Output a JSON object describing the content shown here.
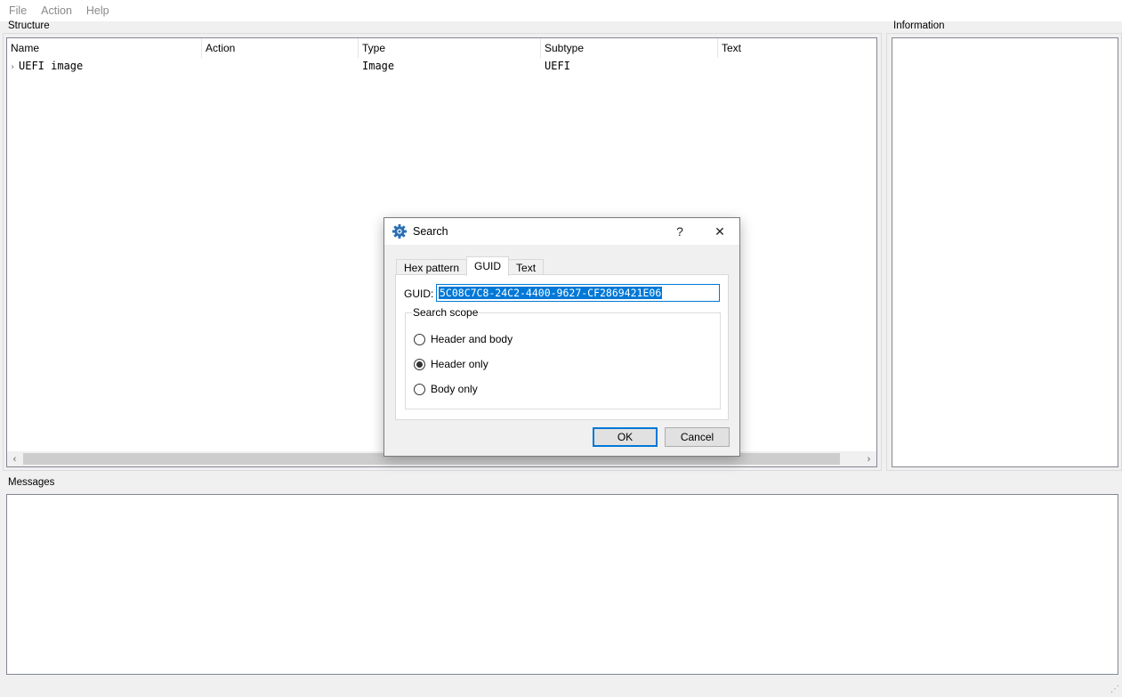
{
  "menubar": {
    "items": [
      "File",
      "Action",
      "Help"
    ]
  },
  "structure": {
    "label": "Structure",
    "columns": [
      "Name",
      "Action",
      "Type",
      "Subtype",
      "Text"
    ],
    "rows": [
      {
        "expander": "›",
        "name": "UEFI image",
        "action": "",
        "type": "Image",
        "subtype": "UEFI",
        "text": ""
      }
    ],
    "scroll_left": "‹",
    "scroll_right": "›"
  },
  "information": {
    "label": "Information"
  },
  "messages": {
    "label": "Messages"
  },
  "dialog": {
    "title": "Search",
    "help_glyph": "?",
    "close_glyph": "✕",
    "tabs": [
      "Hex pattern",
      "GUID",
      "Text"
    ],
    "active_tab": "GUID",
    "guid_label": "GUID:",
    "guid_value": "5C08C7C8-24C2-4400-9627-CF2869421E06",
    "scope": {
      "title": "Search scope",
      "options": [
        "Header and body",
        "Header only",
        "Body only"
      ],
      "selected": "Header only"
    },
    "ok_label": "OK",
    "cancel_label": "Cancel",
    "accent_color": "#0078d7",
    "icon_color": "#2a6fb5"
  }
}
